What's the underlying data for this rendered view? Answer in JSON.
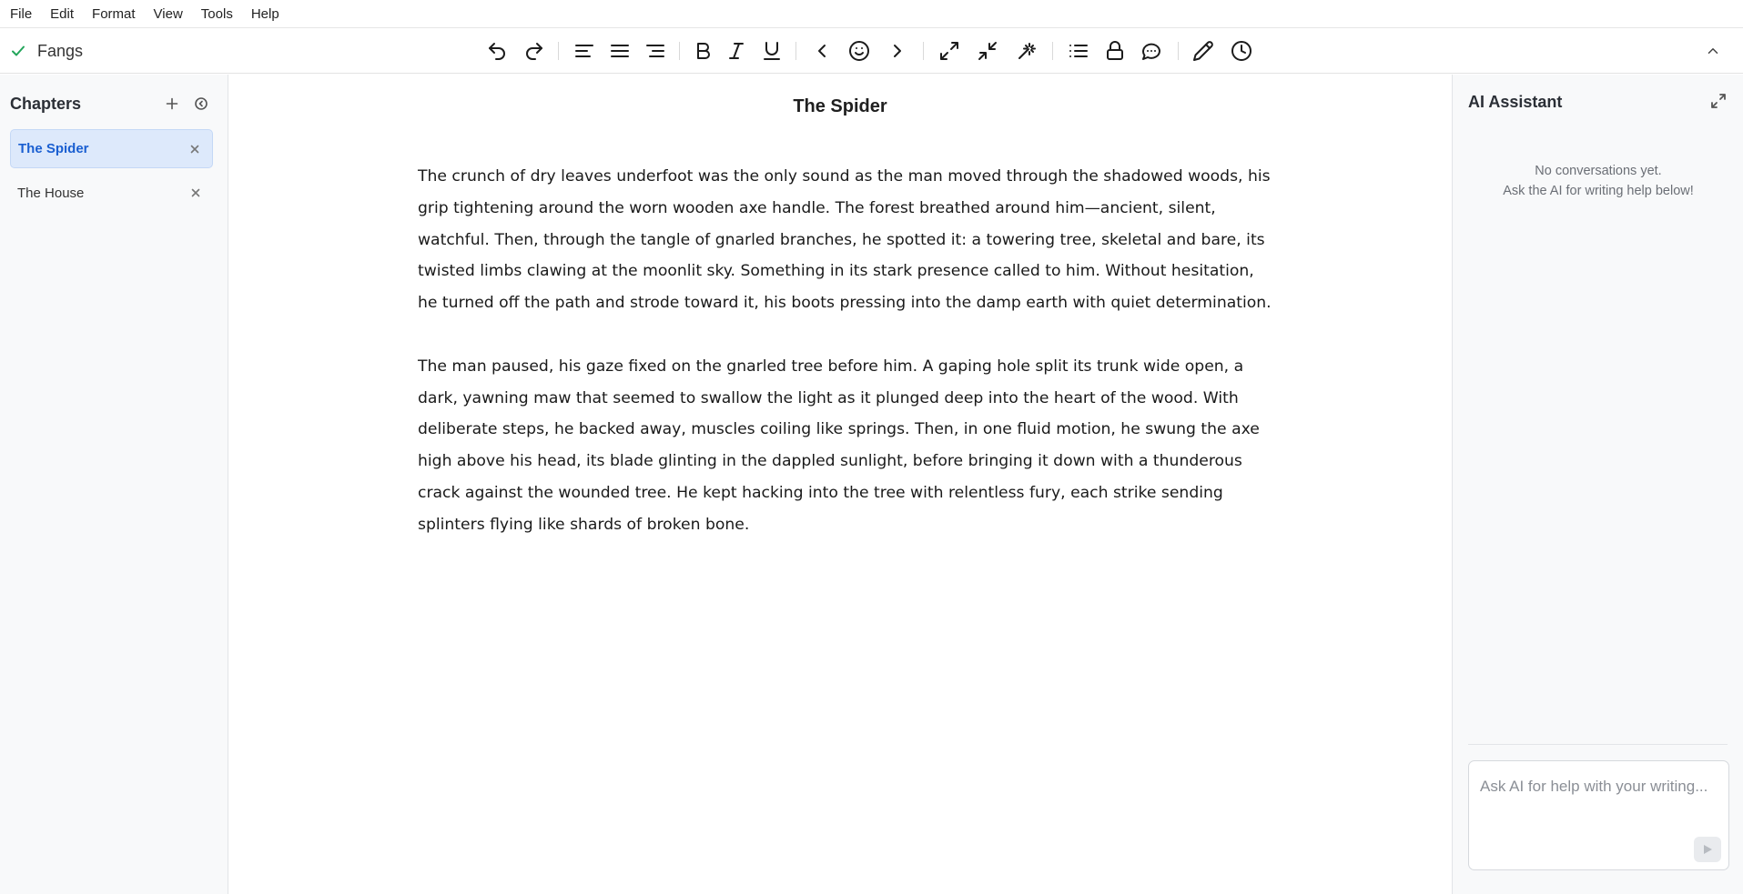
{
  "menu": [
    "File",
    "Edit",
    "Format",
    "View",
    "Tools",
    "Help"
  ],
  "document": {
    "name": "Fangs",
    "status_icon": "check-icon",
    "title": "The Spider",
    "paragraphs": [
      "The crunch of dry leaves underfoot was the only sound as the man moved through the shadowed woods, his grip tightening around the worn wooden axe handle. The forest breathed around him—ancient, silent, watchful. Then, through the tangle of gnarled branches, he spotted it: a towering tree, skeletal and bare, its twisted limbs clawing at the moonlit sky. Something in its stark presence called to him. Without hesitation, he turned off the path and strode toward it, his boots pressing into the damp earth with quiet determination.",
      "The man paused, his gaze fixed on the gnarled tree before him. A gaping hole split its trunk wide open, a dark, yawning maw that seemed to swallow the light as it plunged deep into the heart of the wood. With deliberate steps, he backed away, muscles coiling like springs. Then, in one fluid motion, he swung the axe high above his head, its blade glinting in the dappled sunlight, before bringing it down with a thunderous crack against the wounded tree. He kept hacking into the tree with relentless fury, each strike sending splinters flying like shards of broken bone."
    ]
  },
  "toolbar": {
    "tools": [
      "undo-icon",
      "redo-icon",
      "align-left-icon",
      "align-justify-icon",
      "align-right-icon",
      "bold-icon",
      "italic-icon",
      "underline-icon",
      "chevron-left-icon",
      "emoji-icon",
      "chevron-right-icon",
      "expand-icon",
      "collapse-icon",
      "magic-wand-icon",
      "list-icon",
      "lock-icon",
      "comment-icon",
      "pencil-icon",
      "clock-icon"
    ],
    "collapse_icon": "chevron-up-icon"
  },
  "sidebar": {
    "title": "Chapters",
    "add_icon": "plus-icon",
    "history_icon": "history-icon",
    "chapters": [
      {
        "label": "The Spider",
        "active": true
      },
      {
        "label": "The House",
        "active": false
      }
    ]
  },
  "ai_assistant": {
    "title": "AI Assistant",
    "expand_icon": "fullscreen-icon",
    "empty_line1": "No conversations yet.",
    "empty_line2": "Ask the AI for writing help below!",
    "input_placeholder": "Ask AI for help with your writing...",
    "send_icon": "send-icon"
  },
  "colors": {
    "accent": "#1a5fd1",
    "active_chapter_bg": "#dde9fb",
    "status_check": "#22a55a"
  }
}
